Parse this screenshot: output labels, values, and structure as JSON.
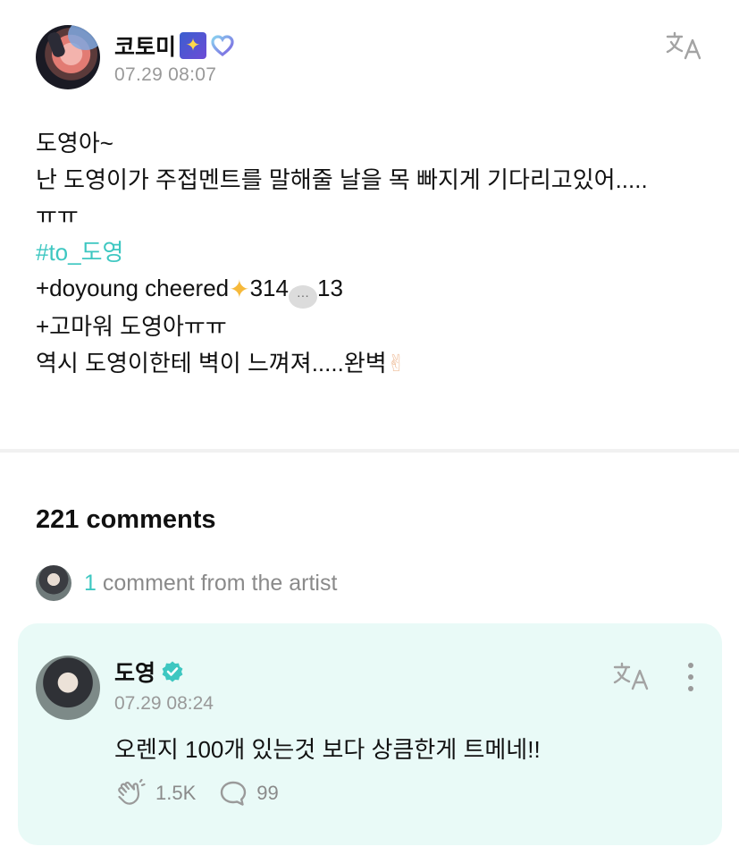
{
  "post": {
    "author_name": "코토미",
    "author_badge_icons": [
      "star-sticker-icon",
      "heart-membership-icon"
    ],
    "timestamp": "07.29 08:07",
    "translate_icon": "translate-icon",
    "lines": [
      "도영아~",
      "난 도영이가 주접멘트를 말해줄 날을 목 빠지게 기다리고있어.....",
      "ㅠㅠ"
    ],
    "hashtag": "#to_도영",
    "cheer_line_prefix": "+doyoung cheered",
    "cheer_count": "314",
    "comment_count": "13",
    "line_thanks": "+고마워 도영아ㅠㅠ",
    "line_last": "역시 도영이한테 벽이 느껴져.....완벽"
  },
  "comments": {
    "count_label": "221 comments",
    "artist_count": "1",
    "artist_label": " comment from the artist"
  },
  "artist_comment": {
    "name": "도영",
    "timestamp": "07.29 08:24",
    "text": "오렌지 100개 있는것 보다 상큼한게 트메네!!",
    "likes": "1.5K",
    "replies": "99"
  },
  "colors": {
    "accent": "#3ec7c1",
    "card_bg": "#e9faf7",
    "muted": "#999999"
  }
}
